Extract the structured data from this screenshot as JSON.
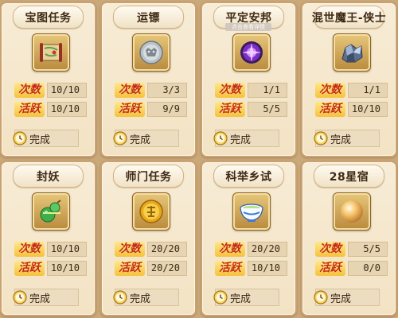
{
  "labels": {
    "count": "次数",
    "active": "活跃",
    "done": "完成"
  },
  "cards": [
    {
      "title": "宝图任务",
      "icon": "treasure-map-icon",
      "count": "10/10",
      "active": "10/10"
    },
    {
      "title": "运镖",
      "icon": "silver-coin-icon",
      "count": "3/3",
      "active": "9/9"
    },
    {
      "title": "平定安邦",
      "icon": "purple-orb-icon",
      "tip": "点击查看详情",
      "count": "1/1",
      "active": "5/5"
    },
    {
      "title": "混世魔王-侠士",
      "icon": "crystal-ore-icon",
      "count": "1/1",
      "active": "10/10"
    },
    {
      "title": "封妖",
      "icon": "green-gourd-icon",
      "count": "10/10",
      "active": "10/10"
    },
    {
      "title": "师门任务",
      "icon": "gold-coin-icon",
      "count": "20/20",
      "active": "20/20"
    },
    {
      "title": "科举乡试",
      "icon": "porcelain-bowl-icon",
      "count": "20/20",
      "active": "10/10"
    },
    {
      "title": "28星宿",
      "icon": "golden-pearl-icon",
      "count": "5/5",
      "active": "0/0"
    }
  ]
}
